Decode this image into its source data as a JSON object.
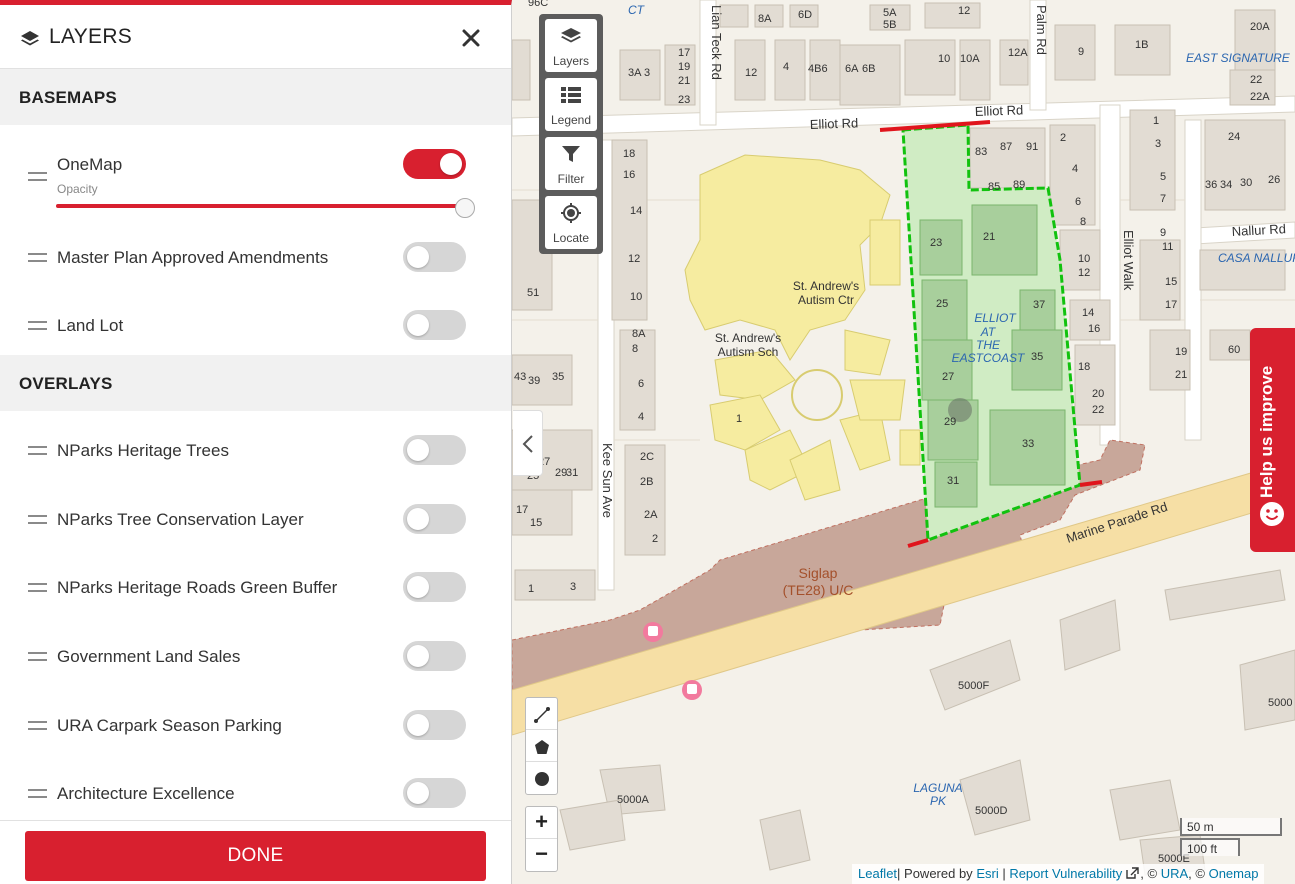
{
  "panel": {
    "title": "LAYERS",
    "basemaps_heading": "BASEMAPS",
    "overlays_heading": "OVERLAYS",
    "opacity_label": "Opacity",
    "opacity_value": 1.0,
    "basemaps": [
      {
        "label": "OneMap",
        "enabled": true
      },
      {
        "label": "Master Plan Approved Amendments",
        "enabled": false
      },
      {
        "label": "Land Lot",
        "enabled": false
      }
    ],
    "overlays": [
      {
        "label": "NParks Heritage Trees",
        "enabled": false
      },
      {
        "label": "NParks Tree Conservation Layer",
        "enabled": false
      },
      {
        "label": "NParks Heritage Roads Green Buffer",
        "enabled": false
      },
      {
        "label": "Government Land Sales",
        "enabled": false
      },
      {
        "label": "URA Carpark Season Parking",
        "enabled": false
      },
      {
        "label": "Architecture Excellence",
        "enabled": false
      }
    ],
    "done_label": "DONE"
  },
  "map_tools": {
    "layers": "Layers",
    "legend": "Legend",
    "filter": "Filter",
    "locate": "Locate"
  },
  "zoom": {
    "in": "+",
    "out": "−"
  },
  "scale": {
    "metric": "50 m",
    "imperial": "100 ft"
  },
  "feedback": {
    "label": "Help us improve"
  },
  "attribution": {
    "leaflet": "Leaflet",
    "powered_by": "| Powered by ",
    "esri": "Esri",
    "sep1": " | ",
    "report": "Report Vulnerability",
    "sep2": ", © ",
    "ura": "URA",
    "sep3": ", © ",
    "onemap": "Onemap"
  },
  "map_labels": {
    "elliot_rd_top": "Elliot Rd",
    "elliot_rd_left": "Elliot Rd",
    "palm_rd": "Palm Rd",
    "lian_teck_rd": "Lian Teck Rd",
    "elliot_walk": "Elliot Walk",
    "kee_sun_ave": "Kee Sun Ave",
    "marine_parade_rd": "Marine Parade Rd",
    "nallur_rd": "Nallur Rd",
    "east_signature": "EAST SIGNATURE",
    "casa_nallur": "CASA NALLUR",
    "standrews_ctr_1": "St. Andrew's",
    "standrews_ctr_2": "Autism Ctr",
    "standrews_sch_1": "St. Andrew's",
    "standrews_sch_2": "Autism Sch",
    "elliot_1": "ELLIOT",
    "elliot_2": "AT",
    "elliot_3": "THE",
    "elliot_4": "EASTCOAST",
    "siglap_1": "Siglap",
    "siglap_2": "(TE28) U/C",
    "laguna_1": "LAGUNA",
    "laguna_2": "PK",
    "ct": "CT",
    "n96c": "96C",
    "n5000f": "5000F",
    "n5000a": "5000A",
    "n5000d": "5000D",
    "n5000e": "5000E",
    "n5000": "5000"
  }
}
